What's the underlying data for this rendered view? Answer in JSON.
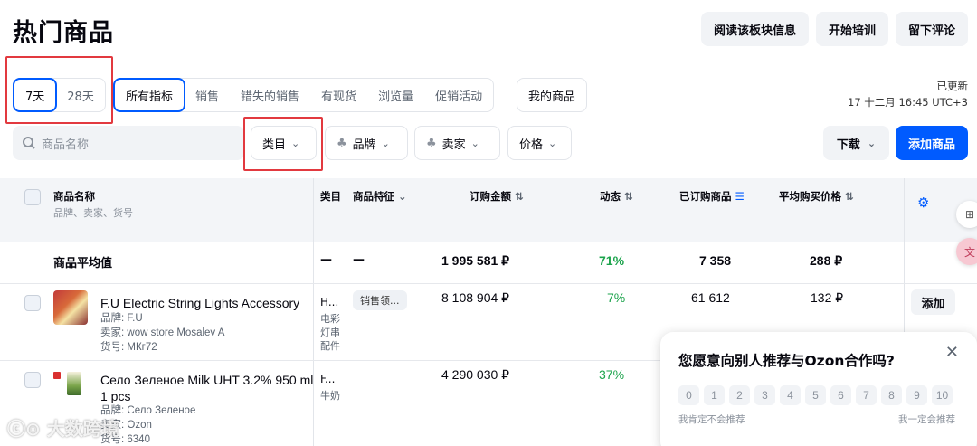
{
  "page": {
    "title": "热门商品"
  },
  "top_buttons": [
    "阅读该板块信息",
    "开始培训",
    "留下评论"
  ],
  "period_tabs": [
    {
      "label": "7天",
      "active": true
    },
    {
      "label": "28天",
      "active": false
    }
  ],
  "metric_tabs": [
    {
      "label": "所有指标",
      "active": true
    },
    {
      "label": "销售",
      "active": false
    },
    {
      "label": "错失的销售",
      "active": false
    },
    {
      "label": "有现货",
      "active": false
    },
    {
      "label": "浏览量",
      "active": false
    },
    {
      "label": "促销活动",
      "active": false
    }
  ],
  "my_products_tab": "我的商品",
  "updated": {
    "label": "已更新",
    "time": "17 十二月 16:45 UTC+3"
  },
  "search": {
    "placeholder": "商品名称"
  },
  "filters": {
    "category": "类目",
    "brand": "品牌",
    "seller": "卖家",
    "price": "价格"
  },
  "actions": {
    "download": "下载",
    "add_product": "添加商品"
  },
  "table": {
    "headers": {
      "name": "商品名称",
      "name_sub": "品牌、卖家、货号",
      "category": "类目",
      "features": "商品特征",
      "order_amount": "订购金额",
      "dynamics": "动态",
      "ordered": "已订购商品",
      "avg_price": "平均购买价格"
    },
    "average_row": {
      "label": "商品平均值",
      "category": "—",
      "features": "—",
      "order_amount": "1 995 581 ₽",
      "dynamics": "71%",
      "ordered": "7 358",
      "avg_price": "288 ₽"
    },
    "rows": [
      {
        "name": "F.U Electric String Lights Accessory",
        "brand": "品牌: F.U",
        "seller": "卖家: wow store Mosalev A",
        "sku": "货号: МКг72",
        "category_short": "H...",
        "category_lines": [
          "电彩",
          "灯串",
          "配件"
        ],
        "feature_tag": "销售领...",
        "order_amount": "8 108 904 ₽",
        "dynamics": "7%",
        "ordered": "61 612",
        "avg_price": "132 ₽",
        "add_label": "添加"
      },
      {
        "name_line1": "Село Зеленое Milk UHT 3.2% 950 ml",
        "name_line2": "1 pcs",
        "brand": "品牌: Село Зеленое",
        "seller": "卖家: Ozon",
        "sku": "货号: 6340",
        "category_short": "F...",
        "category_lines": [
          "牛奶"
        ],
        "order_amount": "4 290 030 ₽",
        "dynamics": "37%"
      }
    ]
  },
  "survey": {
    "question": "您愿意向别人推荐与Ozon合作吗?",
    "scale": [
      "0",
      "1",
      "2",
      "3",
      "4",
      "5",
      "6",
      "7",
      "8",
      "9",
      "10"
    ],
    "low_label": "我肯定不会推荐",
    "high_label": "我一定会推荐"
  },
  "watermark": "大数跨境",
  "colors": {
    "accent": "#005bff",
    "highlight_box": "#e2393f",
    "positive": "#1ba34b"
  }
}
